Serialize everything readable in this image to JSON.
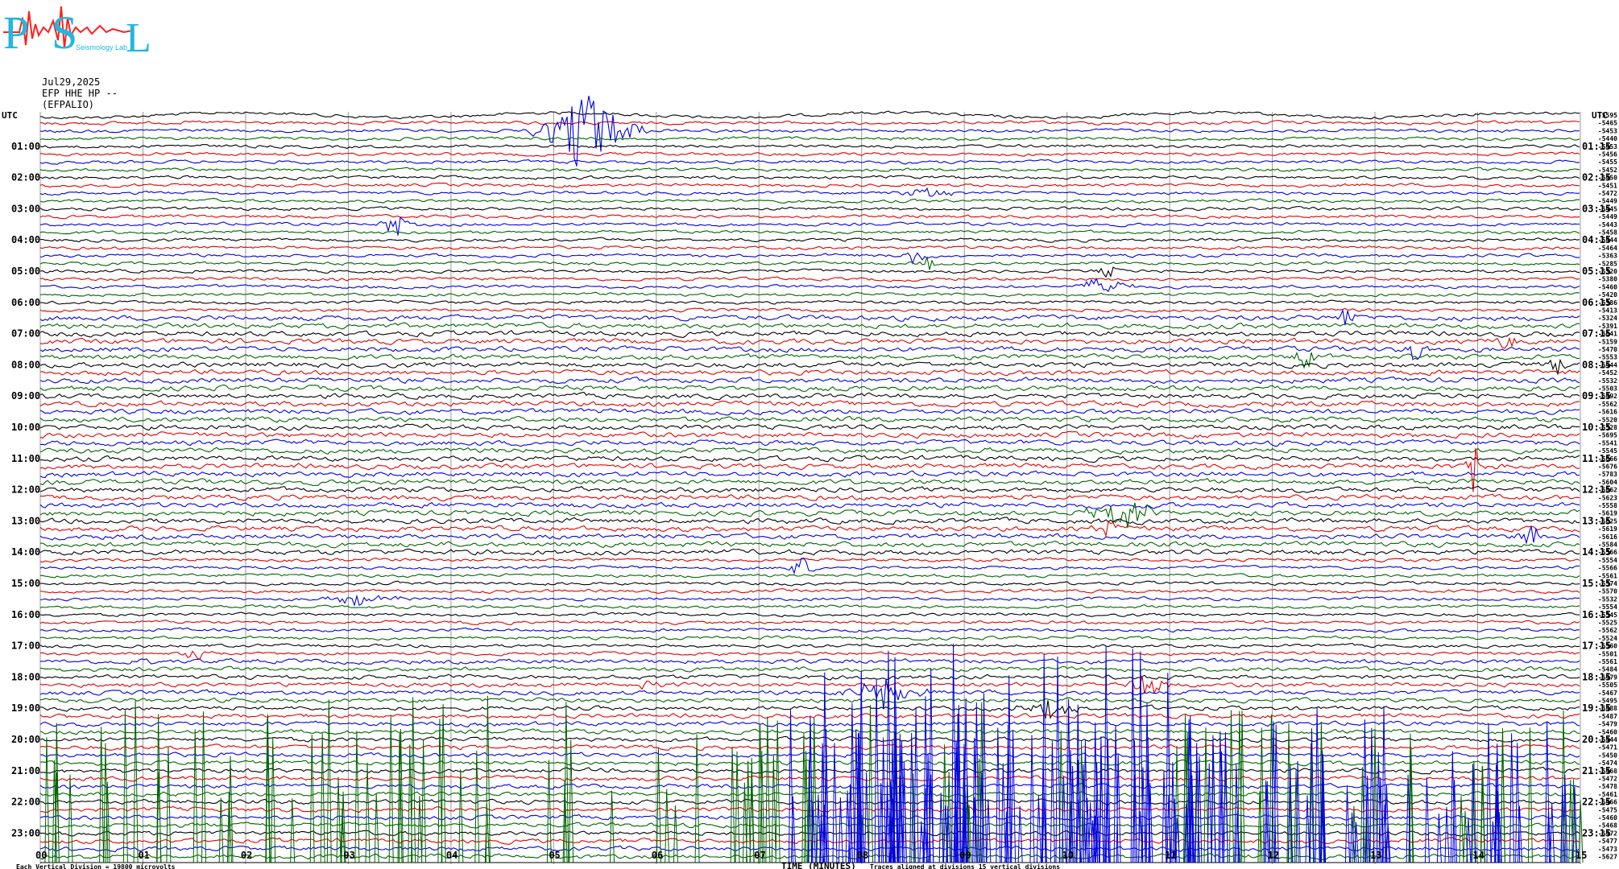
{
  "logo": {
    "letters": [
      "P",
      "S",
      "L"
    ],
    "small_text": "Seismology Lab"
  },
  "header": {
    "date": "Jul29,2025",
    "station": "EFP HHE HP --",
    "station_name": "(EFPALIO)"
  },
  "chart_data": {
    "type": "line",
    "title": "",
    "left_label": "UTC",
    "right_label": "UTC",
    "left_hours": [
      "01:00",
      "02:00",
      "03:00",
      "04:00",
      "05:00",
      "06:00",
      "07:00",
      "08:00",
      "09:00",
      "10:00",
      "11:00",
      "12:00",
      "13:00",
      "14:00",
      "15:00",
      "16:00",
      "17:00",
      "18:00",
      "19:00",
      "20:00",
      "21:00",
      "22:00",
      "23:00"
    ],
    "right_hours": [
      "01:15",
      "02:15",
      "03:15",
      "04:15",
      "05:15",
      "06:15",
      "07:15",
      "08:15",
      "09:15",
      "10:15",
      "11:15",
      "12:15",
      "13:15",
      "14:15",
      "15:15",
      "16:15",
      "17:15",
      "18:15",
      "19:15",
      "20:15",
      "21:15",
      "22:15",
      "23:15"
    ],
    "x_ticks": [
      "00",
      "01",
      "02",
      "03",
      "04",
      "05",
      "06",
      "07",
      "08",
      "09",
      "10",
      "11",
      "12",
      "13",
      "14",
      "15"
    ],
    "xlabel": "TIME (MINUTES)",
    "xlim": [
      0,
      15
    ],
    "trace_count": 96,
    "trace_colors": [
      "#000000",
      "#e00000",
      "#0000e0",
      "#006400"
    ],
    "trace_means": [
      "-5595",
      "-5465",
      "-5453",
      "-5440",
      "-5453",
      "-5456",
      "-5455",
      "-5452",
      "-5450",
      "-5451",
      "-5472",
      "-5449",
      "-5445",
      "-5449",
      "-5443",
      "-5458",
      "-5444",
      "-5464",
      "-5363",
      "-5285",
      "-5320",
      "-5380",
      "-5460",
      "-5420",
      "-5386",
      "-5413",
      "-5324",
      "-5391",
      "-6041",
      "-5159",
      "-5470",
      "-5553",
      "-5444",
      "-5452",
      "-5532",
      "-5503",
      "-5492",
      "-5562",
      "-5616",
      "-5520",
      "-5528",
      "-5695",
      "-5541",
      "-5545",
      "-5666",
      "-5676",
      "-5783",
      "-5604",
      "-5662",
      "-5623",
      "-5558",
      "-5619",
      "-5625",
      "-5619",
      "-5616",
      "-5584",
      "-5566",
      "-5554",
      "-5566",
      "-5561",
      "-5574",
      "-5570",
      "-5532",
      "-5554",
      "-5545",
      "-5525",
      "-5562",
      "-5524",
      "-5560",
      "-5501",
      "-5561",
      "-5484",
      "-5479",
      "-5505",
      "-5467",
      "-5495",
      "-5488",
      "-5487",
      "-5479",
      "-5460",
      "-5444",
      "-5471",
      "-5450",
      "-5474",
      "-5468",
      "-5472",
      "-5478",
      "-5461",
      "-5466",
      "-5475",
      "-5460",
      "-5468",
      "-5472",
      "-5477",
      "-5473",
      "-5627"
    ],
    "footer_left": "Each Vertical Division = 19800 microvolts",
    "footer_right": "Traces aligned at divisions 15 vertical divisions",
    "grid": true
  }
}
